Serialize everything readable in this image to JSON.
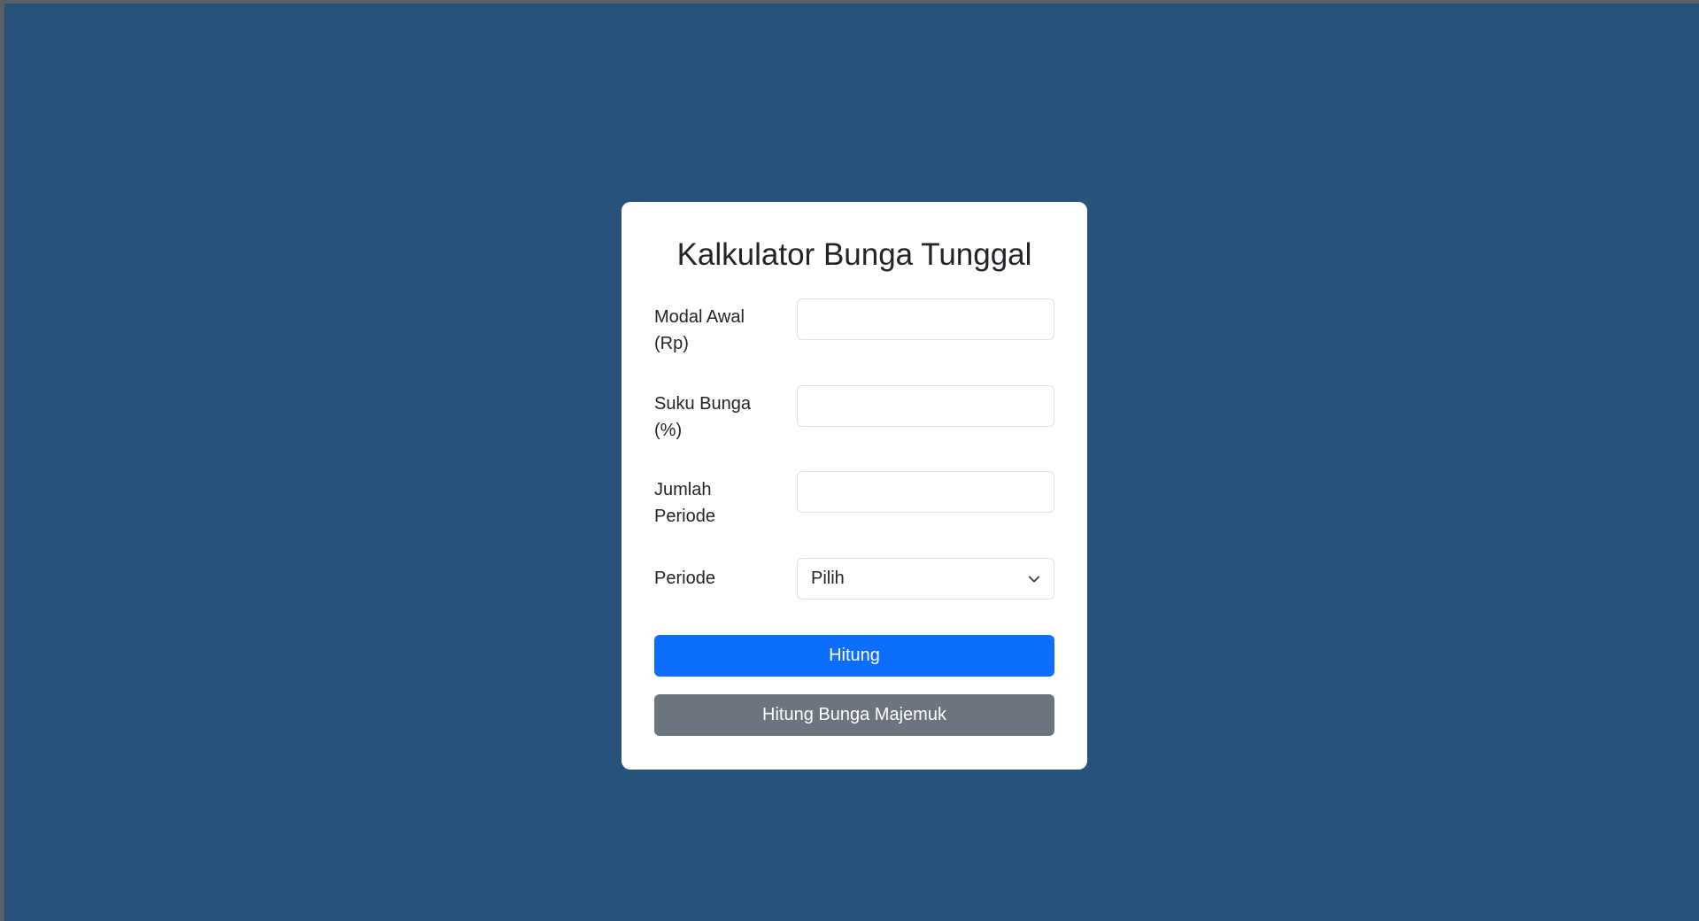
{
  "form": {
    "title": "Kalkulator Bunga Tunggal",
    "fields": [
      {
        "label_line1": "Modal Awal",
        "label_line2": "(Rp)",
        "value": ""
      },
      {
        "label_line1": "Suku Bunga",
        "label_line2": "(%)",
        "value": ""
      },
      {
        "label_line1": "Jumlah",
        "label_line2": "Periode",
        "value": ""
      }
    ],
    "period": {
      "label": "Periode",
      "selected": "Pilih"
    },
    "buttons": {
      "calculate": "Hitung",
      "compound": "Hitung Bunga Majemuk"
    }
  },
  "colors": {
    "background": "#28527a",
    "primary": "#0d6efd",
    "secondary": "#6c757d"
  }
}
